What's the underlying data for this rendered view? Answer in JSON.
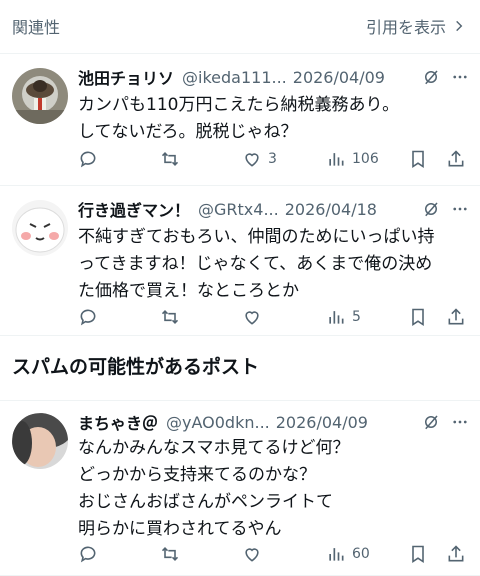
{
  "header": {
    "left_label": "関連性",
    "right_label": "引用を表示"
  },
  "posts": [
    {
      "name": "池田チョリソ",
      "handle": "@ikeda111...",
      "date": "2026/04/09",
      "text": "カンパも110万円こえたら納税義務あり。\nしてないだろ。脱税じゃね？",
      "likes": "3",
      "views": "106"
    },
    {
      "name": "行き過ぎマン！",
      "handle": "@GRtx4...",
      "date": "2026/04/18",
      "text": "不純すぎておもろい、仲間のためにいっぱい持\nってきますね！じゃなくて、あくまで俺の決め\nた価格で買え！なところとか",
      "likes": "",
      "views": "5"
    },
    {
      "name": "まちゃき＠",
      "handle": "@yAO0dkn...",
      "date": "2026/04/09",
      "text": "なんかみんなスマホ見てるけど何？\nどっかから支持来てるのかな？\nおじさんおばさんがペンライトて\n明らかに買わされてるやん",
      "likes": "",
      "views": "60"
    }
  ],
  "section_title": "スパムの可能性があるポスト",
  "colors": {
    "text": "#0f1419",
    "muted": "#536471",
    "divider": "#eff3f4"
  }
}
